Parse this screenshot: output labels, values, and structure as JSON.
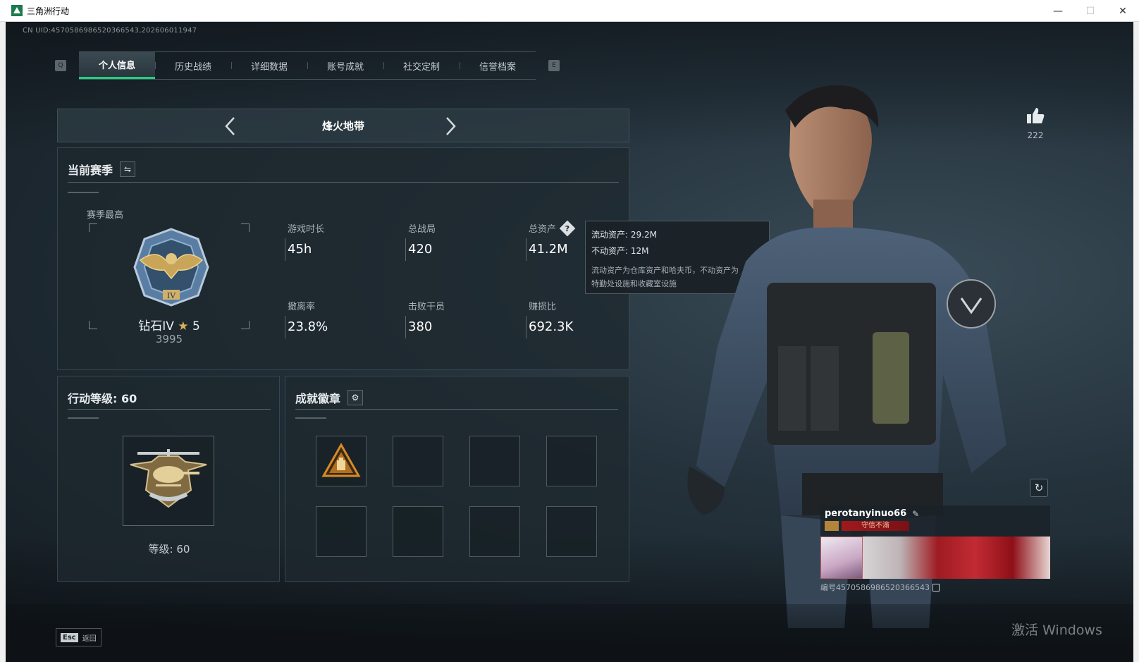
{
  "window": {
    "title": "三角洲行动",
    "controls": {
      "minimize": "—",
      "maximize": "☐",
      "close": "✕"
    }
  },
  "header": {
    "uid": "CN UID:4570586986520366543,202606011947",
    "tab_keys": {
      "left": "Q",
      "right": "E"
    },
    "tabs": [
      {
        "label": "个人信息",
        "active": true
      },
      {
        "label": "历史战绩",
        "active": false
      },
      {
        "label": "详细数据",
        "active": false
      },
      {
        "label": "账号成就",
        "active": false
      },
      {
        "label": "社交定制",
        "active": false
      },
      {
        "label": "信誉档案",
        "active": false
      }
    ]
  },
  "mode_selector": {
    "prev_icon": "chevron-left-icon",
    "next_icon": "chevron-right-icon",
    "title": "烽火地带"
  },
  "season": {
    "title": "当前赛季",
    "switch_icon": "swap-icon",
    "best_label": "赛季最高",
    "rank": {
      "name": "钻石IV",
      "star_icon": "★",
      "stars": "5",
      "score": "3995"
    },
    "stats": [
      {
        "label": "游戏时长",
        "value": "45h"
      },
      {
        "label": "总战局",
        "value": "420"
      },
      {
        "label": "总资产",
        "value": "41.2M",
        "help": "?"
      },
      {
        "label": "撤离率",
        "value": "23.8%"
      },
      {
        "label": "击败干员",
        "value": "380"
      },
      {
        "label": "赚损比",
        "value": "692.3K"
      }
    ]
  },
  "asset_tooltip": {
    "liquid": "流动资产: 29.2M",
    "fixed": "不动资产: 12M",
    "note_line1": "流动资产为仓库资产和哈夫币，不动资产为",
    "note_line2": "特勤处设施和收藏室设施"
  },
  "level": {
    "title": "行动等级: 60",
    "level_label": "等级: 60"
  },
  "achievements": {
    "title": "成就徽章",
    "settings_icon": "gear-icon",
    "slot_count": 8,
    "filled_slot_icon": "triangle-badge-icon"
  },
  "profile": {
    "likes": "222",
    "like_icon": "thumbs-up-icon",
    "refresh_icon": "refresh-icon",
    "player_name": "perotanyinuo66",
    "edit_icon": "✎",
    "title_badge": "守信不渝",
    "player_id": "编号4570586986520366543"
  },
  "footer": {
    "esc_key": "Esc",
    "esc_label": "返回"
  },
  "watermark": "激活 Windows",
  "colors": {
    "accent": "#21d07e",
    "panel_bg": "#1e282e",
    "rank_star": "#d9b35a",
    "title_ribbon": "#a1191c"
  }
}
